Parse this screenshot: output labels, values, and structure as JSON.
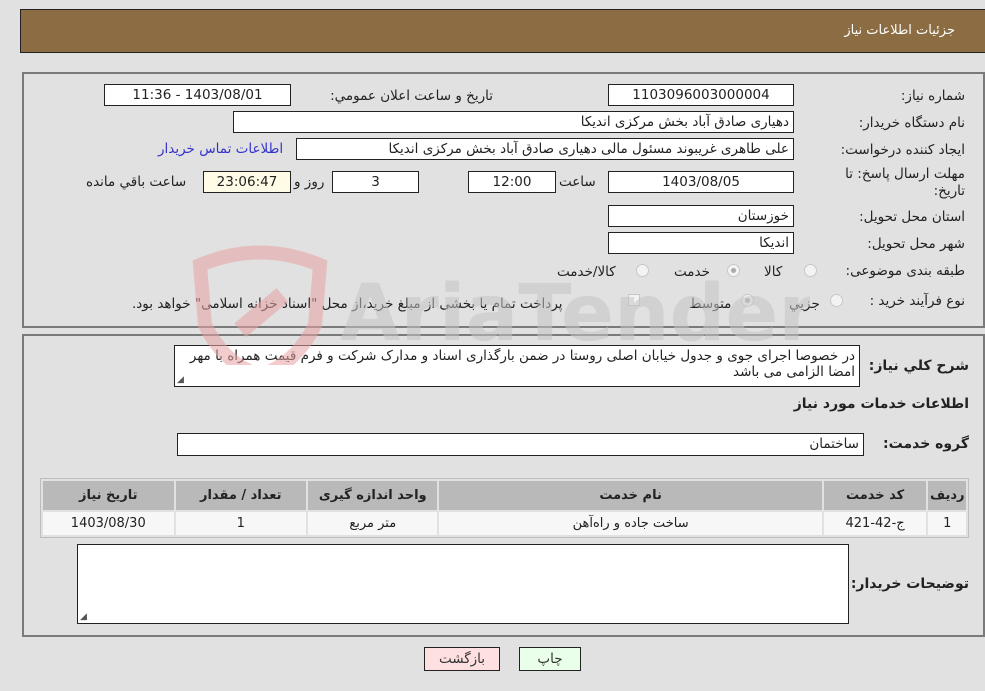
{
  "header": {
    "title": "جزئیات اطلاعات نیاز"
  },
  "fields": {
    "need_number": {
      "label": "شماره نیاز:",
      "value": "1103096003000004"
    },
    "announce_datetime": {
      "label": "تاریخ و ساعت اعلان عمومي:",
      "value": "1403/08/01 - 11:36"
    },
    "buyer_org": {
      "label": "نام دستگاه خریدار:",
      "value": "دهیاری صادق آباد بخش مرکزی اندیکا"
    },
    "requester": {
      "label": "ایجاد کننده درخواست:",
      "value": "علی طاهری غریبوند مسئول مالی  دهیاری صادق آباد بخش مرکزی اندیکا"
    },
    "buyer_contact_link": "اطلاعات تماس خریدار",
    "deadline": {
      "label_line1": "مهلت ارسال پاسخ: تا",
      "label_line2": "تاریخ:",
      "date": "1403/08/05",
      "time_label": "ساعت",
      "time": "12:00",
      "days": "3",
      "days_label": "روز و",
      "remaining": "23:06:47",
      "remaining_label": "ساعت باقي مانده"
    },
    "province": {
      "label": "استان محل تحویل:",
      "value": "خوزستان"
    },
    "city": {
      "label": "شهر محل تحویل:",
      "value": "اندیکا"
    },
    "category": {
      "label": "طبقه بندی موضوعی:",
      "options": [
        "کالا",
        "خدمت",
        "کالا/خدمت"
      ],
      "selected": "خدمت"
    },
    "purchase_type": {
      "label": "نوع فرآیند خرید :",
      "options": [
        "جزيي",
        "متوسط"
      ],
      "selected": "متوسط",
      "treasury_note": "پرداخت تمام یا بخشی از مبلغ خرید،از محل \"اسناد خزانه اسلامی\" خواهد بود."
    }
  },
  "description": {
    "label": "شرح کلي نیاز:",
    "value": "در خصوصا اجرای جوی و جدول خیابان  اصلی روستا  در ضمن بارگذاری اسناد و مدارک شرکت و فرم قیمت همراه با مهر امضا الزامی می باشد"
  },
  "services_section": {
    "title": "اطلاعات خدمات مورد نیاز",
    "group_label": "گروه خدمت:",
    "group_value": "ساختمان"
  },
  "table": {
    "headers": [
      "ردیف",
      "کد خدمت",
      "نام خدمت",
      "واحد اندازه گیری",
      "تعداد / مقدار",
      "تاریخ نیاز"
    ],
    "rows": [
      [
        "1",
        "ج-42-421",
        "ساخت جاده و راه‌آهن",
        "متر مربع",
        "1",
        "1403/08/30"
      ]
    ]
  },
  "buyer_notes": {
    "label": "توضیحات خریدار:",
    "value": ""
  },
  "buttons": {
    "print": "چاپ",
    "back": "بازگشت"
  },
  "watermark": {
    "text": "AriaTender.neT"
  }
}
